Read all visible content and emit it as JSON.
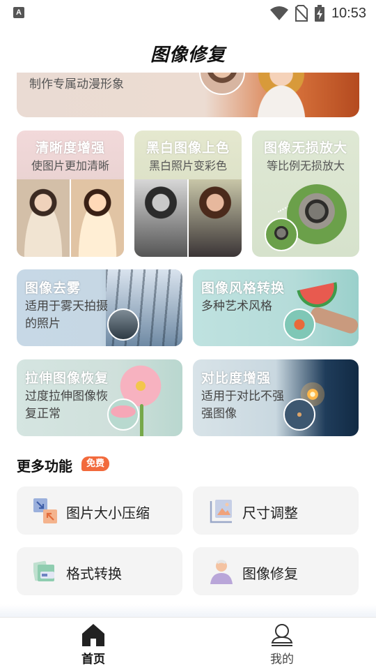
{
  "status_bar": {
    "app_icon": "A",
    "time": "10:53",
    "icons": [
      "wifi-icon",
      "no-sim-icon",
      "battery-charging-icon"
    ]
  },
  "header": {
    "title": "图像修复"
  },
  "top_banner": {
    "subtitle": "制作专属动漫形象"
  },
  "feature_cards_row1": [
    {
      "title": "清晰度增强",
      "subtitle": "使图片更加清晰"
    },
    {
      "title": "黑白图像上色",
      "subtitle": "黑白照片变彩色"
    },
    {
      "title": "图像无损放大",
      "subtitle": "等比例无损放大"
    }
  ],
  "feature_cards_row2": [
    {
      "title": "图像去雾",
      "subtitle": "适用于雾天拍摄的照片"
    },
    {
      "title": "图像风格转换",
      "subtitle": "多种艺术风格"
    },
    {
      "title": "拉伸图像恢复",
      "subtitle": "过度拉伸图像恢复正常"
    },
    {
      "title": "对比度增强",
      "subtitle": "适用于对比不强强图像"
    }
  ],
  "more_section": {
    "title": "更多功能",
    "badge": "免费",
    "tools": [
      {
        "label": "图片大小压缩",
        "icon": "compress-icon"
      },
      {
        "label": "尺寸调整",
        "icon": "resize-icon"
      },
      {
        "label": "格式转换",
        "icon": "format-convert-icon"
      },
      {
        "label": "图像修复",
        "icon": "portrait-repair-icon"
      }
    ]
  },
  "bottom_nav": {
    "items": [
      {
        "label": "首页",
        "icon": "home-icon",
        "active": true
      },
      {
        "label": "我的",
        "icon": "profile-icon",
        "active": false
      }
    ]
  },
  "colors": {
    "badge": "#f26a3c",
    "tool_button_bg": "#f4f4f4",
    "nav_active": "#111111"
  }
}
